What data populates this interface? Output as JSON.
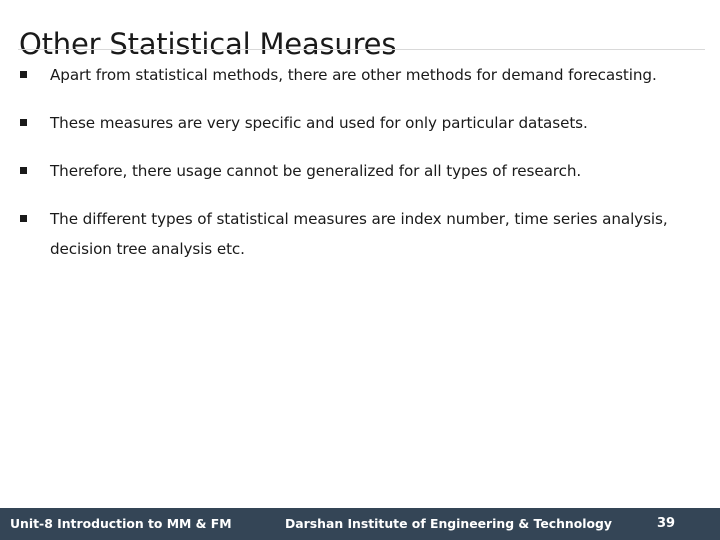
{
  "slide": {
    "title": "Other Statistical Measures",
    "bullet_marker_glyph": "square-bullet",
    "bullets": [
      {
        "text": "Apart from statistical methods, there are other methods for demand forecasting.",
        "justified": true
      },
      {
        "text": "These measures are very specific and used for only particular datasets.",
        "justified": true
      },
      {
        "text": "Therefore, there usage cannot be generalized for all types of research.",
        "justified": true
      },
      {
        "text": "The different types of statistical measures are index number, time series analysis, decision tree analysis etc.",
        "justified": false
      }
    ]
  },
  "footer": {
    "left_label": "Unit-8 Introduction to MM & FM",
    "center_label": "Darshan Institute of Engineering & Technology",
    "page_number": "39",
    "background_color": "#344556",
    "text_color": "#ffffff"
  },
  "colors": {
    "title_text": "#1a1a1a",
    "body_text": "#1a1a1a",
    "divider": "#d9d9d9",
    "slide_background": "#ffffff"
  }
}
